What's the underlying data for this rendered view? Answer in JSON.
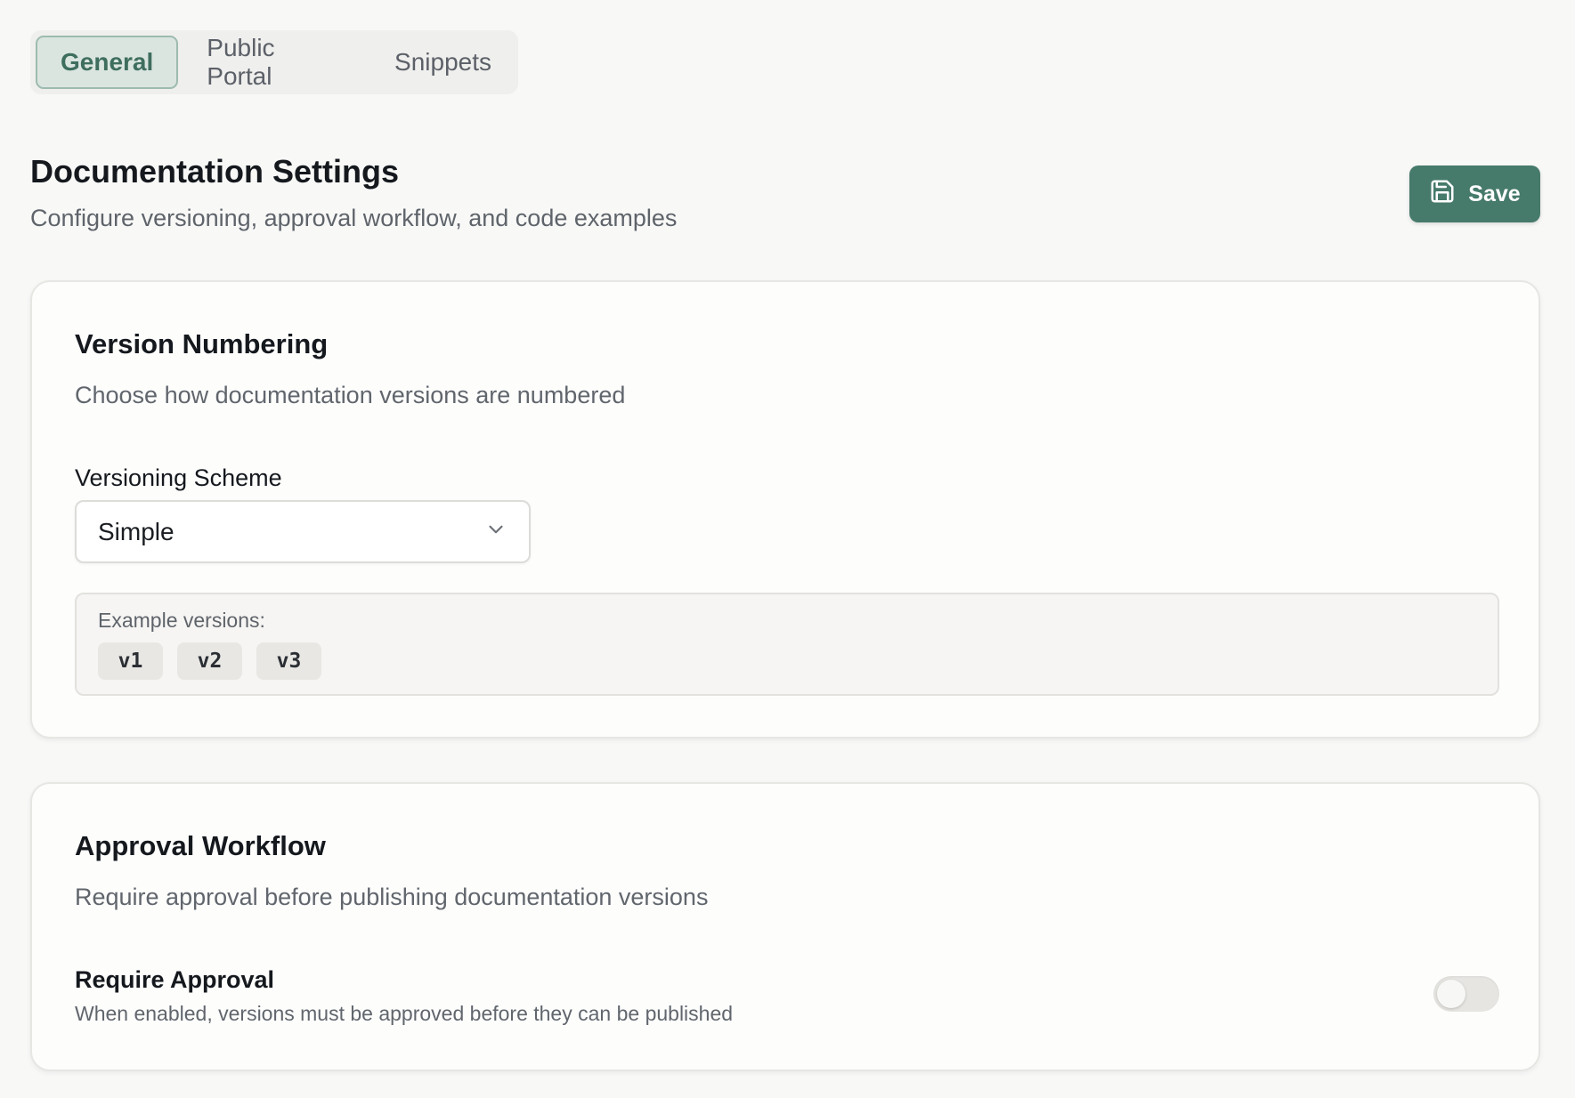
{
  "tabs": [
    {
      "label": "General",
      "active": true
    },
    {
      "label": "Public Portal",
      "active": false
    },
    {
      "label": "Snippets",
      "active": false
    }
  ],
  "header": {
    "title": "Documentation Settings",
    "subtitle": "Configure versioning, approval workflow, and code examples",
    "save_label": "Save",
    "save_icon": "save-icon"
  },
  "version_numbering": {
    "title": "Version Numbering",
    "description": "Choose how documentation versions are numbered",
    "scheme_label": "Versioning Scheme",
    "scheme_value": "Simple",
    "examples_label": "Example versions:",
    "examples": [
      "v1",
      "v2",
      "v3"
    ]
  },
  "approval_workflow": {
    "title": "Approval Workflow",
    "description": "Require approval before publishing documentation versions",
    "toggle_title": "Require Approval",
    "toggle_description": "When enabled, versions must be approved before they can be published",
    "toggle_enabled": false
  },
  "colors": {
    "accent": "#467a6b",
    "active_tab_bg": "#dbe5e0",
    "background": "#f8f8f7"
  }
}
